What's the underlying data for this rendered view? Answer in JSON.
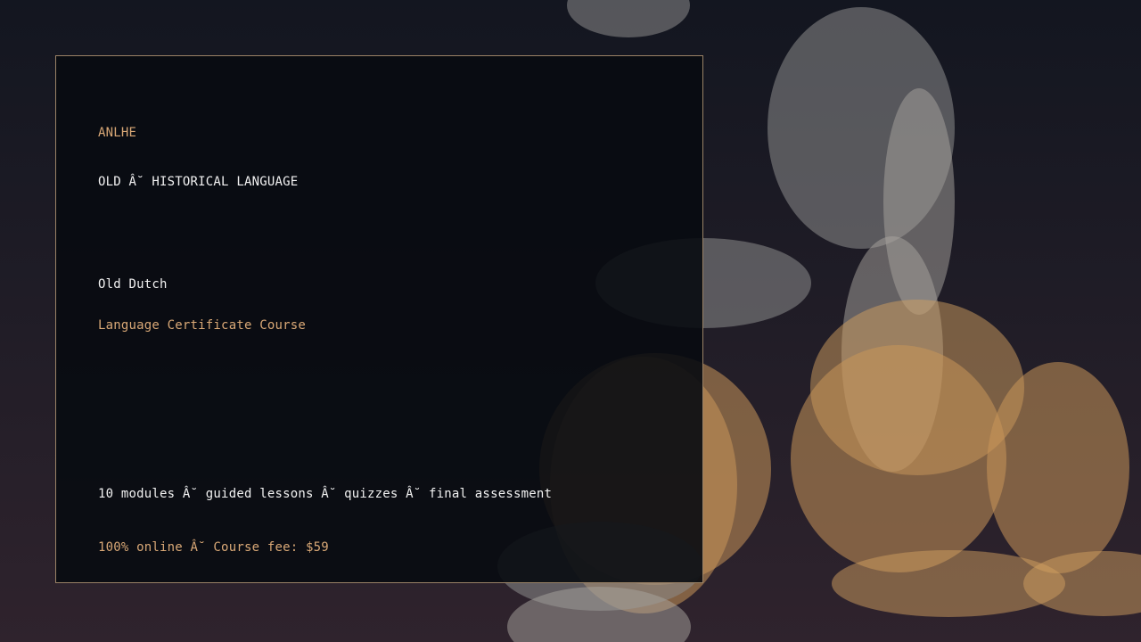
{
  "brand": "ANLHE",
  "category": "OLD Â˘ HISTORICAL LANGUAGE",
  "language": "Old Dutch",
  "course_type": "Language Certificate Course",
  "details": "10 modules Â˘ guided lessons Â˘ quizzes Â˘ final assessment",
  "pricing": "100% online Â˘ Course fee: $59",
  "colors": {
    "accent": "#d9a876",
    "text": "#f2f2f2",
    "card_border": "#9a8266",
    "card_bg": "#080b11"
  }
}
